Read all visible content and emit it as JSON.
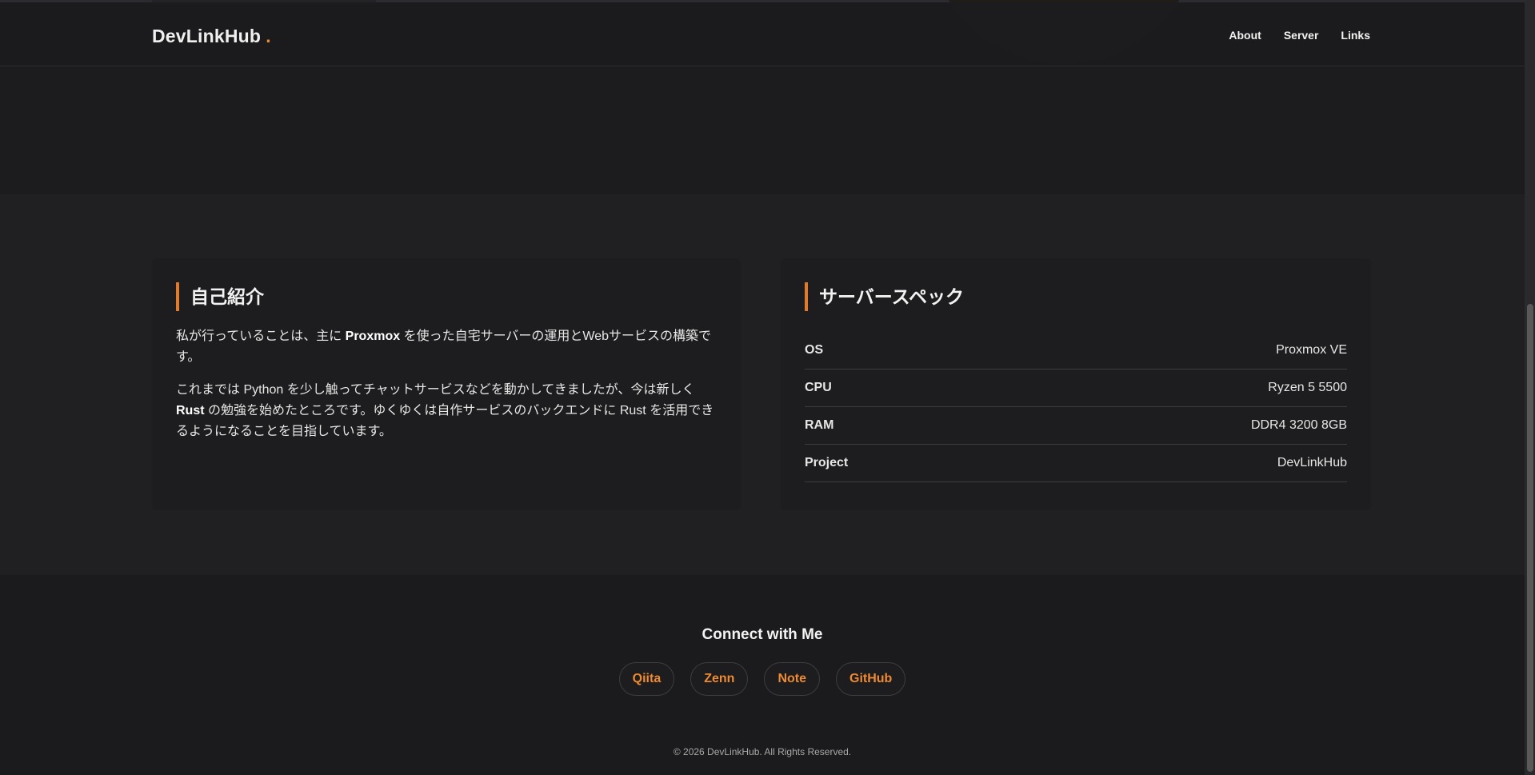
{
  "header": {
    "logo": "DevLinkHub",
    "logo_dot": ".",
    "nav": [
      "About",
      "Server",
      "Links"
    ]
  },
  "about": {
    "title": "自己紹介",
    "p1": [
      {
        "t": "私が行っていることは、主に ",
        "b": false
      },
      {
        "t": "Proxmox",
        "b": true
      },
      {
        "t": " を使った自宅サーバーの運用とWebサービスの構築です。",
        "b": false
      }
    ],
    "p2": [
      {
        "t": "これまでは Python を少し触ってチャットサービスなどを動かしてきましたが、今は新しく ",
        "b": false
      },
      {
        "t": "Rust",
        "b": true
      },
      {
        "t": " の勉強を始めたところです。ゆくゆくは自作サービスのバックエンドに Rust を活用できるようになることを目指しています。",
        "b": false
      }
    ]
  },
  "server": {
    "title": "サーバースペック",
    "specs": [
      {
        "key": "OS",
        "value": "Proxmox VE"
      },
      {
        "key": "CPU",
        "value": "Ryzen 5 5500"
      },
      {
        "key": "RAM",
        "value": "DDR4 3200 8GB"
      },
      {
        "key": "Project",
        "value": "DevLinkHub"
      }
    ]
  },
  "connect": {
    "title": "Connect with Me",
    "links": [
      "Qiita",
      "Zenn",
      "Note",
      "GitHub"
    ]
  },
  "footer": {
    "text": "© 2026 DevLinkHub. All Rights Reserved."
  },
  "colors": {
    "accent": "#ee8a33",
    "background": "#1b1b1d",
    "card": "#1d1d1f"
  }
}
